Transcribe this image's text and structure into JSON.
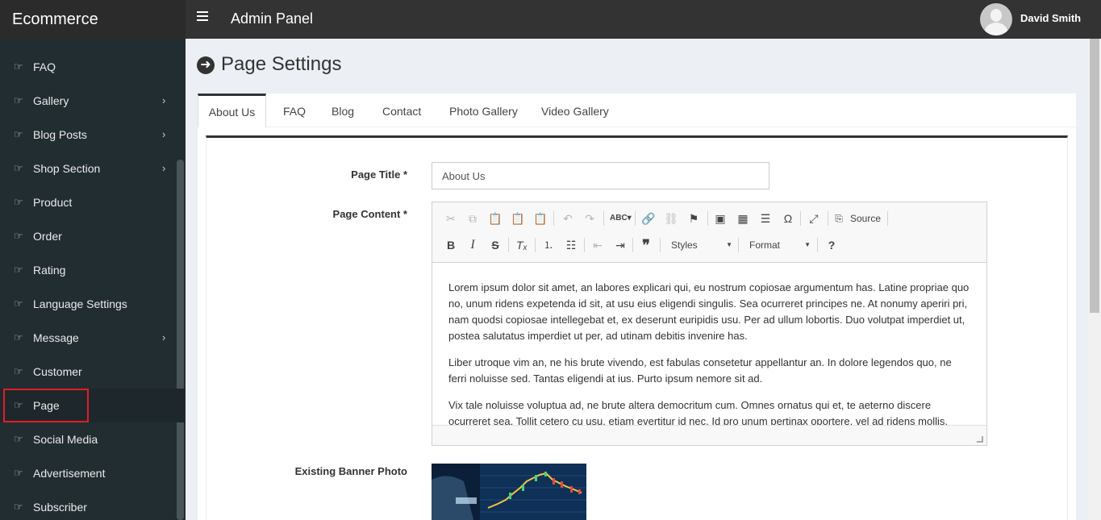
{
  "header": {
    "logo": "Ecommerce",
    "title": "Admin Panel",
    "user_name": "David Smith"
  },
  "sidebar": {
    "items": [
      {
        "label": "FAQ",
        "has_children": false
      },
      {
        "label": "Gallery",
        "has_children": true
      },
      {
        "label": "Blog Posts",
        "has_children": true
      },
      {
        "label": "Shop Section",
        "has_children": true
      },
      {
        "label": "Product",
        "has_children": false
      },
      {
        "label": "Order",
        "has_children": false
      },
      {
        "label": "Rating",
        "has_children": false
      },
      {
        "label": "Language Settings",
        "has_children": false
      },
      {
        "label": "Message",
        "has_children": true
      },
      {
        "label": "Customer",
        "has_children": false
      },
      {
        "label": "Page",
        "has_children": false,
        "active": true
      },
      {
        "label": "Social Media",
        "has_children": false
      },
      {
        "label": "Advertisement",
        "has_children": false
      },
      {
        "label": "Subscriber",
        "has_children": false
      }
    ],
    "icon": "hand-pointer-icon",
    "chevron": "›",
    "highlight_color": "#e01e25"
  },
  "page": {
    "heading": "Page Settings",
    "heading_icon": "arrow-circle-right-icon"
  },
  "tabs": [
    {
      "label": "About Us",
      "active": true
    },
    {
      "label": "FAQ"
    },
    {
      "label": "Blog"
    },
    {
      "label": "Contact"
    },
    {
      "label": "Photo Gallery"
    },
    {
      "label": "Video Gallery"
    }
  ],
  "form": {
    "title_label": "Page Title *",
    "title_value": "About Us",
    "content_label": "Page Content *",
    "banner_label": "Existing Banner Photo"
  },
  "editor": {
    "source_label": "Source",
    "styles_label": "Styles",
    "format_label": "Format",
    "paragraphs": [
      "Lorem ipsum dolor sit amet, an labores explicari qui, eu nostrum copiosae argumentum has. Latine propriae quo no, unum ridens expetenda id sit, at usu eius eligendi singulis. Sea ocurreret principes ne. At nonumy aperiri pri, nam quodsi copiosae intellegebat et, ex deserunt euripidis usu. Per ad ullum lobortis. Duo volutpat imperdiet ut, postea salutatus imperdiet ut per, ad utinam debitis invenire has.",
      "Liber utroque vim an, ne his brute vivendo, est fabulas consetetur appellantur an. In dolore legendos quo, ne ferri noluisse sed. Tantas eligendi at ius. Purto ipsum nemore sit ad.",
      "Vix tale noluisse voluptua ad, ne brute altera democritum cum. Omnes ornatus qui et, te aeterno discere ocurreret sea. Tollit cetero cu usu, etiam evertitur id nec. Id pro unum pertinax oportere, vel ad ridens mollis."
    ]
  },
  "colors": {
    "header_bg": "#333333",
    "sidebar_bg": "#222d32",
    "content_bg": "#ecf0f5"
  }
}
